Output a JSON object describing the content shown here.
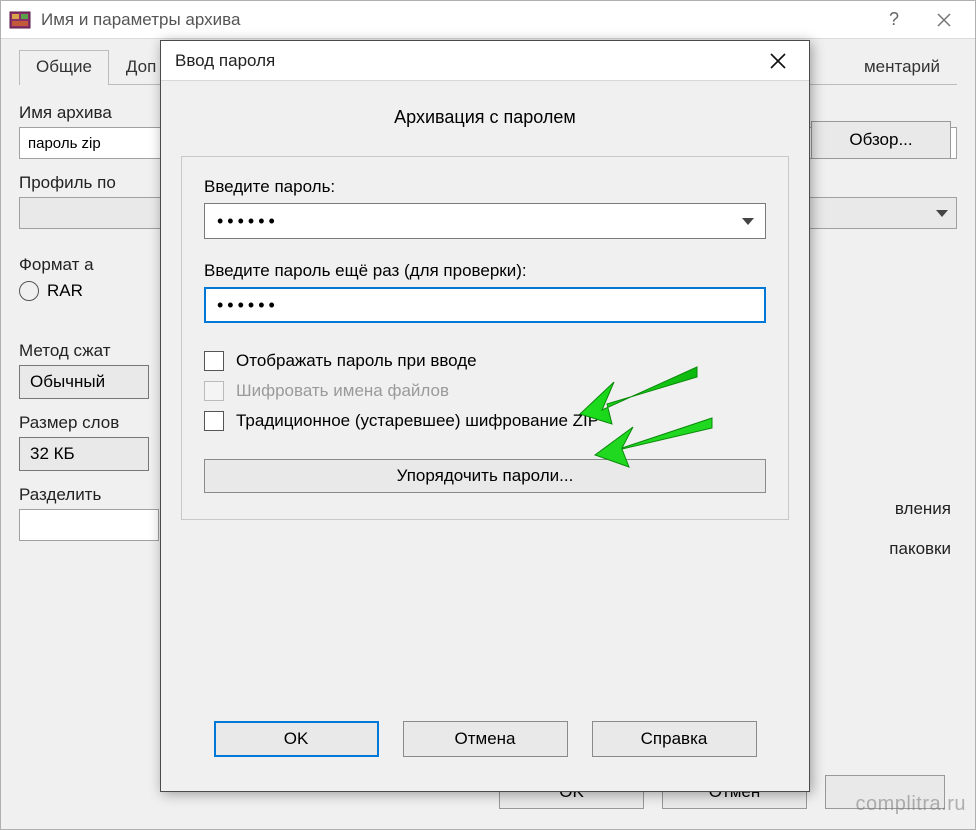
{
  "parent": {
    "title": "Имя и параметры архива",
    "tabs": {
      "general": "Общие",
      "advanced_partial": "Доп",
      "comment_partial": "ментарий"
    },
    "archive_name_label": "Имя архива",
    "archive_name_value": "пароль zip",
    "browse_button": "Обзор...",
    "profile_label": "Профиль по",
    "format_group": "Формат а",
    "format_rar": "RAR",
    "method_label": "Метод сжат",
    "method_value": "Обычный",
    "dict_label": "Размер слов",
    "dict_value": "32 КБ",
    "split_label": "Разделить ",
    "right_text_1": "вления",
    "right_text_2": "паковки",
    "ok": "OK",
    "cancel": "Отмен"
  },
  "modal": {
    "title": "Ввод пароля",
    "heading": "Архивация с паролем",
    "password_label": "Введите пароль:",
    "password_value": "••••••",
    "password_confirm_label": "Введите пароль ещё раз (для проверки):",
    "password_confirm_value": "••••••",
    "show_password": "Отображать пароль при вводе",
    "encrypt_names": "Шифровать имена файлов",
    "legacy_zip": "Традиционное (устаревшее) шифрование ZIP",
    "organize": "Упорядочить пароли...",
    "ok": "OK",
    "cancel": "Отмена",
    "help": "Справка"
  },
  "watermark": "complitra.ru"
}
